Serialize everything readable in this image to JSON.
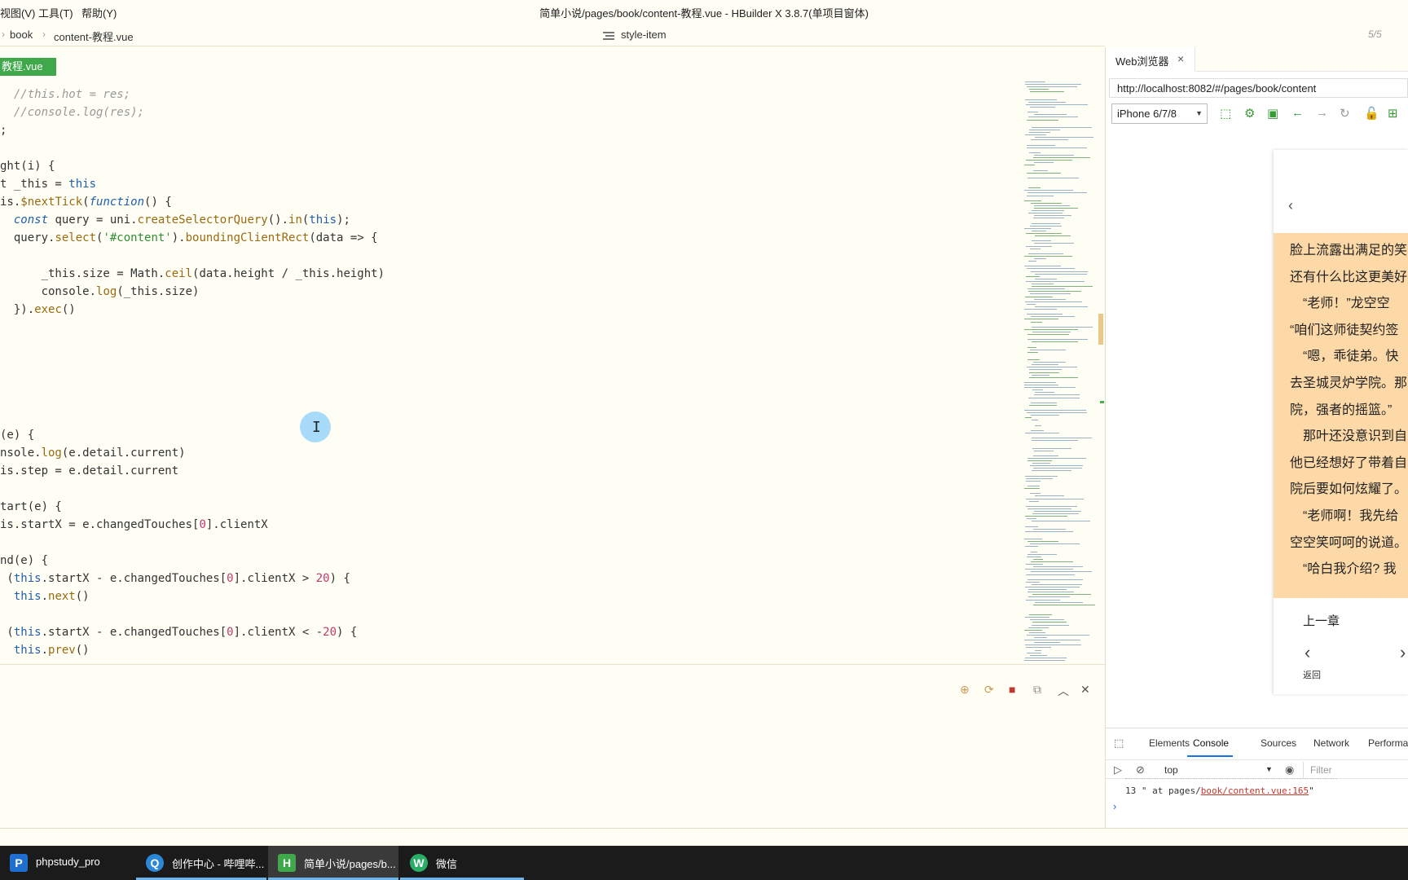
{
  "window": {
    "title": "简单小说/pages/book/content-教程.vue - HBuilder X 3.8.7(单项目窗体)",
    "menus": [
      "视图(V)",
      "工具(T)",
      "帮助(Y)"
    ]
  },
  "breadcrumb": {
    "items": [
      "book",
      "content-教程.vue"
    ]
  },
  "outline": {
    "label": "style-item"
  },
  "pager": "5/5",
  "editor": {
    "active_tab": "教程.vue",
    "lines": [
      "  //this.hot = res;",
      "  //console.log(res);",
      ";",
      "",
      "ght(i) {",
      "t _this = this",
      "is.$nextTick(function() {",
      "  const query = uni.createSelectorQuery().in(this);",
      "  query.select('#content').boundingClientRect(data => {",
      "",
      "      _this.size = Math.ceil(data.height / _this.height)",
      "      console.log(_this.size)",
      "  }).exec()",
      "",
      "",
      "",
      "",
      "",
      "",
      "(e) {",
      "nsole.log(e.detail.current)",
      "is.step = e.detail.current",
      "",
      "tart(e) {",
      "is.startX = e.changedTouches[0].clientX",
      "",
      "nd(e) {",
      " (this.startX - e.changedTouches[0].clientX > 20) {",
      "  this.next()",
      "",
      " (this.startX - e.changedTouches[0].clientX < -20) {",
      "  this.prev()"
    ]
  },
  "browser": {
    "tab_label": "Web浏览器",
    "url": "http://localhost:8082/#/pages/book/content",
    "device": "iPhone 6/7/8",
    "phone": {
      "reader_lines": [
        "脸上流露出满足的笑",
        "还有什么比这更美好",
        "　“老师！”龙空空",
        "“咱们这师徒契约签",
        "　“嗯，乖徒弟。快",
        "去圣城灵炉学院。那",
        "院，强者的摇篮。”",
        "　那叶还没意识到自",
        "他已经想好了带着自",
        "院后要如何炫耀了。",
        "　“老师啊！我先给",
        "空空笑呵呵的说道。",
        "　“哈白我介绍? 我"
      ],
      "prev_chapter": "上一章",
      "back_label": "返回"
    },
    "devtools": {
      "tabs": [
        "Elements",
        "Console",
        "Sources",
        "Network",
        "Performa"
      ],
      "active_tab": "Console",
      "context": "top",
      "filter_placeholder": "Filter",
      "log_prefix": "13 \" at pages/",
      "log_link": "book/content.vue:165",
      "log_suffix": "\""
    }
  },
  "taskbar": {
    "items": [
      {
        "label": "phpstudy_pro",
        "icon": "P"
      },
      {
        "label": "创作中心 - 哔哩哔...",
        "icon": "Q"
      },
      {
        "label": "简单小说/pages/b...",
        "icon": "H"
      },
      {
        "label": "微信",
        "icon": "W"
      }
    ]
  },
  "colors": {
    "accent_green": "#3fa84b",
    "editor_bg": "#fffef5",
    "reader_bg": "#fdd9a8",
    "cursor_highlight": "#78c8fa"
  }
}
